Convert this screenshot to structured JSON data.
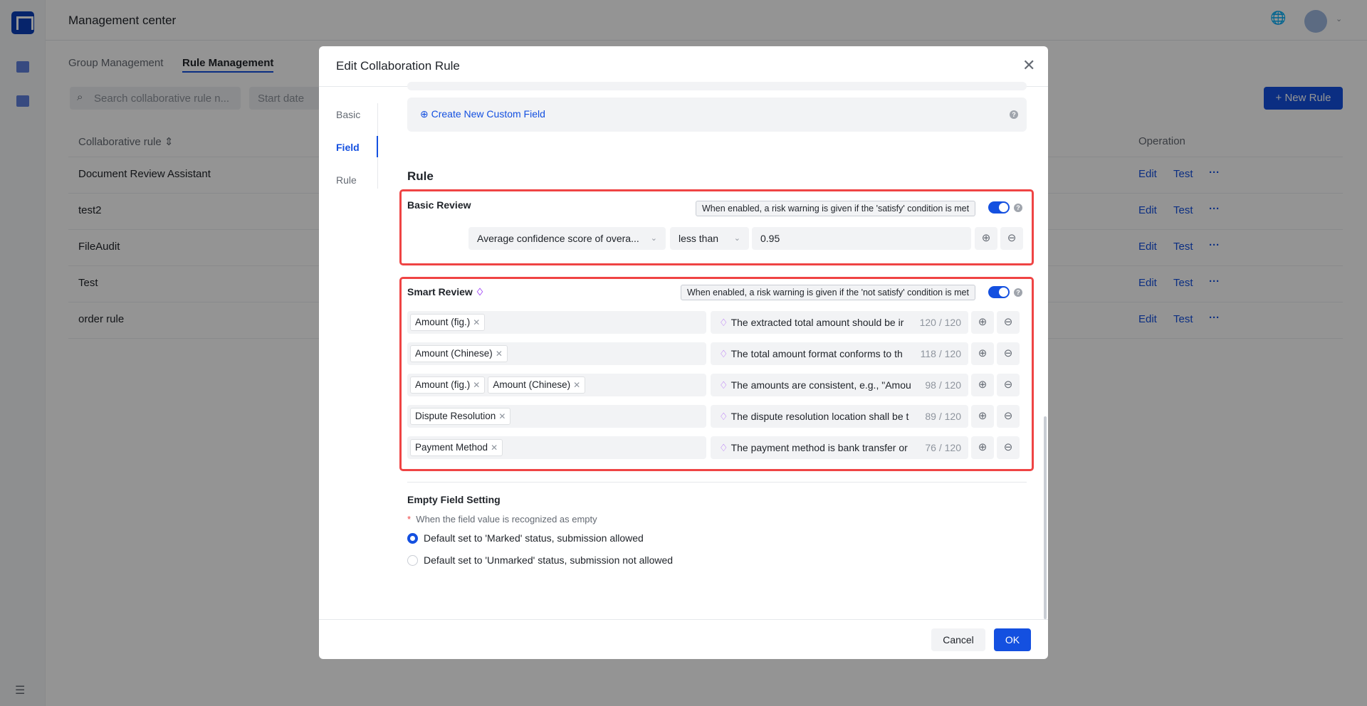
{
  "app": {
    "title": "Management center",
    "icons": [
      "logo",
      "sidebar-rule-icon",
      "sidebar-doc-icon",
      "globe-icon",
      "avatar",
      "menu-collapse-icon"
    ]
  },
  "tabs": [
    {
      "label": "Group Management"
    },
    {
      "label": "Rule Management",
      "active": true
    }
  ],
  "filters": {
    "search_placeholder": "Search collaborative rule n...",
    "start_date_placeholder": "Start date"
  },
  "new_rule_label": "+ New Rule",
  "table": {
    "columns": [
      "Collaborative rule",
      "Operation"
    ],
    "rows": [
      {
        "name": "Document Review Assistant"
      },
      {
        "name": "test2"
      },
      {
        "name": "FileAudit"
      },
      {
        "name": "Test"
      },
      {
        "name": "order rule"
      }
    ],
    "actions": {
      "edit": "Edit",
      "test": "Test",
      "more": "···"
    }
  },
  "modal": {
    "title": "Edit Collaboration Rule",
    "nav": [
      {
        "label": "Basic"
      },
      {
        "label": "Field",
        "active": true
      },
      {
        "label": "Rule"
      }
    ],
    "create_field": "Create New Custom Field",
    "rule_heading": "Rule",
    "basic": {
      "title": "Basic Review",
      "tip": "When enabled, a risk warning is given if the 'satisfy' condition is met",
      "enabled": true,
      "metric": "Average confidence score of overa...",
      "operator": "less than",
      "value": "0.95"
    },
    "smart": {
      "title": "Smart Review",
      "tip": "When enabled, a risk warning is given if the 'not satisfy' condition is met",
      "enabled": true,
      "rows": [
        {
          "fields": [
            "Amount (fig.)"
          ],
          "text": "The extracted total amount should be ir",
          "count": "120 / 120"
        },
        {
          "fields": [
            "Amount (Chinese)"
          ],
          "text": "The total amount format conforms to th",
          "count": "118 / 120"
        },
        {
          "fields": [
            "Amount (fig.)",
            "Amount (Chinese)"
          ],
          "text": "The amounts are consistent, e.g., \"Amou",
          "count": "98 / 120"
        },
        {
          "fields": [
            "Dispute Resolution"
          ],
          "text": "The dispute resolution location shall be t",
          "count": "89 / 120"
        },
        {
          "fields": [
            "Payment Method"
          ],
          "text": "The payment method is bank transfer or",
          "count": "76 / 120"
        }
      ]
    },
    "empty": {
      "title": "Empty Field Setting",
      "required_mark": "*",
      "desc": "When the field value is recognized as empty",
      "options": [
        {
          "label": "Default set to 'Marked' status, submission allowed",
          "selected": true
        },
        {
          "label": "Default set to 'Unmarked' status, submission not allowed",
          "selected": false
        }
      ]
    },
    "cancel": "Cancel",
    "ok": "OK"
  },
  "colors": {
    "primary": "#1450e0",
    "highlight": "#ef4444"
  }
}
